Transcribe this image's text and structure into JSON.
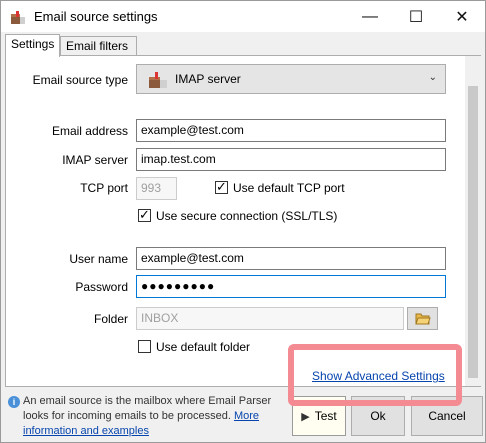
{
  "window": {
    "title": "Email source settings",
    "min_glyph": "—",
    "max_glyph": "☐",
    "close_glyph": "✕"
  },
  "tabs": [
    {
      "label": "Settings",
      "active": true
    },
    {
      "label": "Email filters",
      "active": false
    }
  ],
  "source": {
    "label": "Email source type",
    "value": "IMAP server",
    "icon": "mailbox-icon"
  },
  "email_address": {
    "label": "Email address",
    "value": "example@test.com"
  },
  "imap_server": {
    "label": "IMAP server",
    "value": "imap.test.com"
  },
  "tcp_port": {
    "label": "TCP port",
    "value": "993",
    "default_checkbox_label": "Use default TCP port",
    "default_checked": true
  },
  "secure": {
    "label": "Use secure connection (SSL/TLS)",
    "checked": true
  },
  "user_name": {
    "label": "User name",
    "value": "example@test.com"
  },
  "password": {
    "label": "Password",
    "value": "●●●●●●●●●"
  },
  "folder": {
    "label": "Folder",
    "value": "INBOX",
    "default_checkbox_label": "Use default folder",
    "default_checked": false
  },
  "advanced_link": "Show Advanced Settings",
  "footer": {
    "text": "An email source is the mailbox where Email Parser looks for incoming emails to be processed. ",
    "link": "More information and examples"
  },
  "buttons": {
    "test": "Test",
    "ok": "Ok",
    "cancel": "Cancel"
  },
  "colors": {
    "highlight": "#f48a92",
    "link": "#0645ad",
    "focus": "#0078d7"
  }
}
